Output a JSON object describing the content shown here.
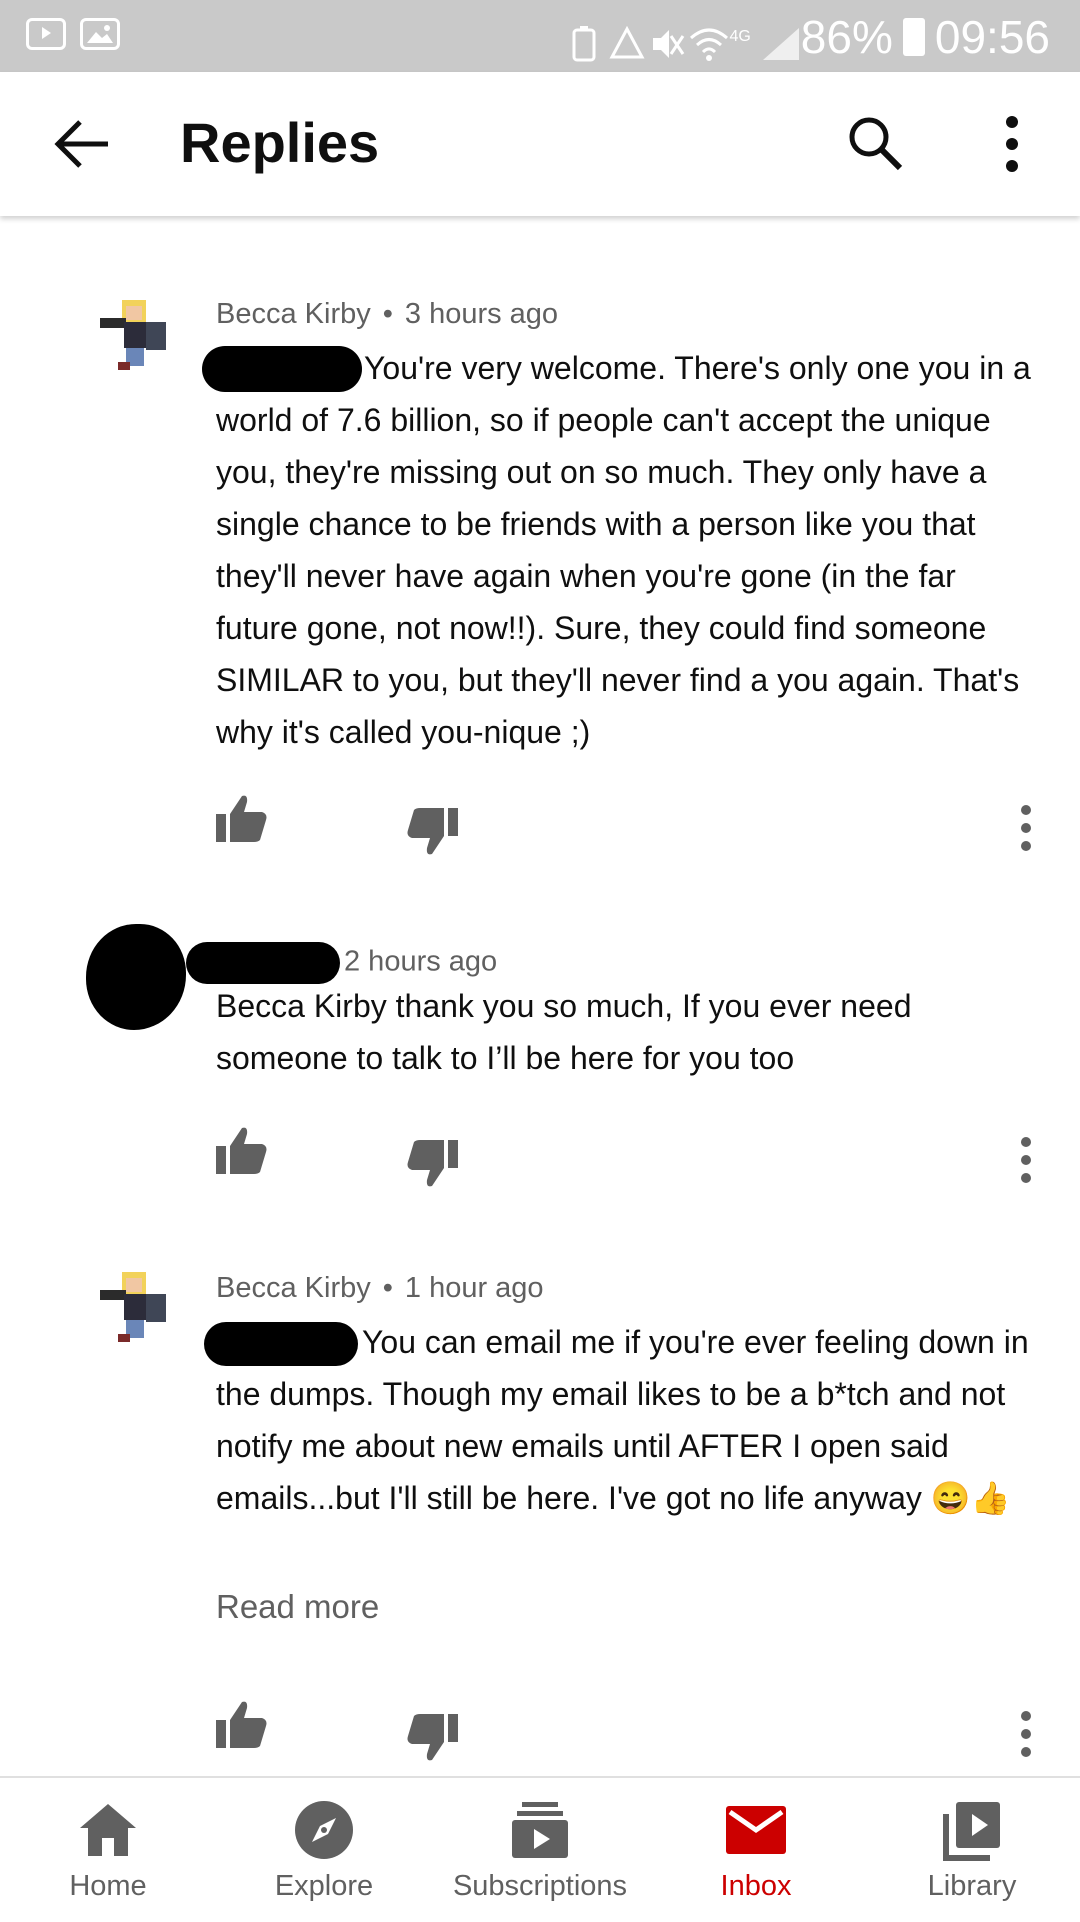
{
  "status_bar": {
    "battery": "86%",
    "time": "09:56",
    "network_label": "4G"
  },
  "header": {
    "title": "Replies"
  },
  "comments": [
    {
      "author": "Becca Kirby",
      "time": "3 hours ago",
      "text": "You're very welcome.  There's only one you in a world of 7.6 billion, so if people can't accept the unique you, they're missing out on so much.  They only have a single chance to be friends with a person like you that they'll never have again when you're gone (in the far future gone, not now!!).  Sure, they could find someone SIMILAR to you, but they'll never find a you again.  That's why it's called you-nique ;)"
    },
    {
      "author": "",
      "time": "2 hours ago",
      "text": "Becca Kirby thank you so much, If you ever need someone to talk to I’ll be here for you too"
    },
    {
      "author": "Becca Kirby",
      "time": "1 hour ago",
      "text": "You can email me if you're ever feeling down in the dumps.  Though my email likes to be a b*tch and not notify me about new emails until AFTER I open said emails...but I'll still be here.  I've got no life anyway 😄👍",
      "read_more": "Read more"
    }
  ],
  "bottom_nav": [
    {
      "label": "Home",
      "icon": "home-icon"
    },
    {
      "label": "Explore",
      "icon": "explore-icon"
    },
    {
      "label": "Subscriptions",
      "icon": "subscriptions-icon"
    },
    {
      "label": "Inbox",
      "icon": "inbox-icon",
      "active": true
    },
    {
      "label": "Library",
      "icon": "library-icon"
    }
  ],
  "colors": {
    "accent": "#cc0000",
    "status_bar": "#c9c9c9",
    "secondary_text": "#606060"
  }
}
